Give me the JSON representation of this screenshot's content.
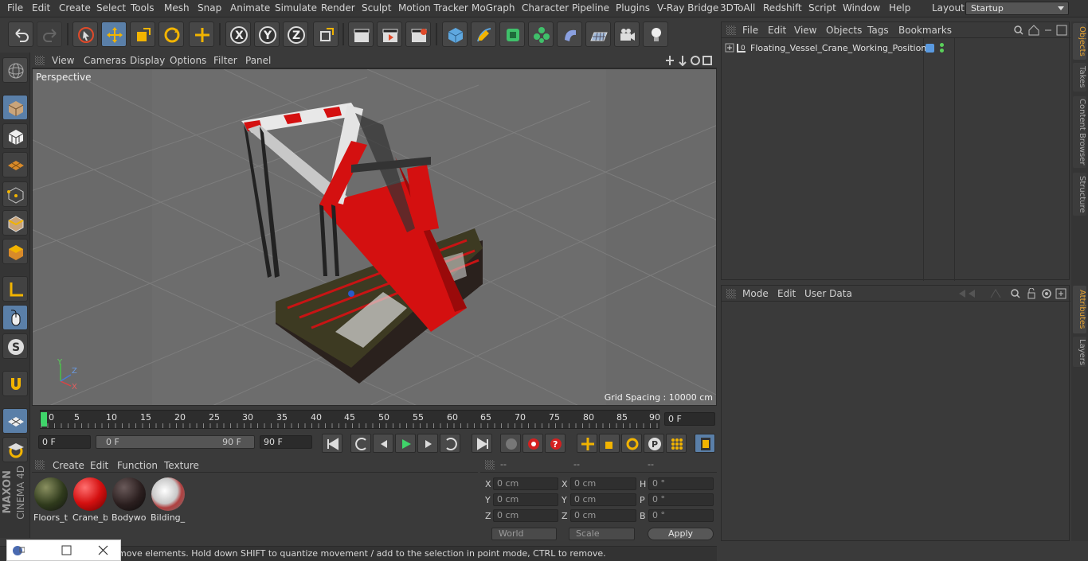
{
  "menubar": {
    "items": [
      "File",
      "Edit",
      "Create",
      "Select",
      "Tools",
      "Mesh",
      "Snap",
      "Animate",
      "Simulate",
      "Render",
      "Sculpt",
      "Motion Tracker",
      "MoGraph",
      "Character",
      "Pipeline",
      "Plugins",
      "V-Ray Bridge",
      "3DToAll",
      "Redshift",
      "Script",
      "Window",
      "Help"
    ],
    "layout_label": "Layout:",
    "layout_value": "Startup"
  },
  "viewport": {
    "menu": [
      "View",
      "Cameras",
      "Display",
      "Options",
      "Filter",
      "Panel"
    ],
    "label": "Perspective",
    "grid_spacing": "Grid Spacing : 10000 cm",
    "axis": {
      "x": "X",
      "y": "Y",
      "z": "Z"
    }
  },
  "timeline": {
    "ticks": [
      "0",
      "5",
      "10",
      "15",
      "20",
      "25",
      "30",
      "35",
      "40",
      "45",
      "50",
      "55",
      "60",
      "65",
      "70",
      "75",
      "80",
      "85",
      "90"
    ],
    "current_frame": "0 F",
    "start_frame": "0 F",
    "range_start": "0 F",
    "range_end": "90 F",
    "end_frame": "90 F"
  },
  "materials": {
    "menu": [
      "Create",
      "Edit",
      "Function",
      "Texture"
    ],
    "items": [
      {
        "name": "Floors_t",
        "color": "#2f3a1c"
      },
      {
        "name": "Crane_b",
        "color": "#d41010"
      },
      {
        "name": "Bodywo",
        "color": "#2a1e1e"
      },
      {
        "name": "Bilding_",
        "color": "#c8c8c8"
      }
    ]
  },
  "coords": {
    "headers": [
      "--",
      "--",
      "--"
    ],
    "rows": [
      {
        "a": "X",
        "av": "0 cm",
        "b": "X",
        "bv": "0 cm",
        "c": "H",
        "cv": "0 °"
      },
      {
        "a": "Y",
        "av": "0 cm",
        "b": "Y",
        "bv": "0 cm",
        "c": "P",
        "cv": "0 °"
      },
      {
        "a": "Z",
        "av": "0 cm",
        "b": "Z",
        "bv": "0 cm",
        "c": "B",
        "cv": "0 °"
      }
    ],
    "mode": "World",
    "transform": "Scale",
    "apply": "Apply"
  },
  "status": {
    "text": "move elements. Hold down SHIFT to quantize movement / add to the selection in point mode, CTRL to remove."
  },
  "objects": {
    "menu": [
      "File",
      "Edit",
      "View",
      "Objects",
      "Tags",
      "Bookmarks"
    ],
    "items": [
      {
        "name": "Floating_Vessel_Crane_Working_Position"
      }
    ]
  },
  "attributes": {
    "menu": [
      "Mode",
      "Edit",
      "User Data"
    ]
  },
  "right_tabs": [
    "Objects",
    "Takes",
    "Content Browser",
    "Structure",
    "Attributes",
    "Layers"
  ],
  "brand": {
    "line1": "MAXON",
    "line2": "CINEMA 4D"
  },
  "colors": {
    "accent": "#5a7fa8",
    "crane_red": "#d41010",
    "tab_active": "#e9a634"
  }
}
